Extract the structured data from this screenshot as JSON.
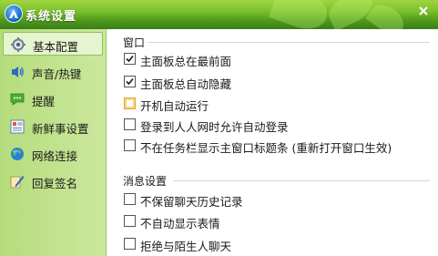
{
  "window": {
    "title": "系统设置",
    "close_label": "✕"
  },
  "sidebar": {
    "items": [
      {
        "label": "基本配置",
        "icon": "gear-icon",
        "active": true
      },
      {
        "label": "声音/热键",
        "icon": "speaker-icon",
        "active": false
      },
      {
        "label": "提醒",
        "icon": "chat-bubble-icon",
        "active": false
      },
      {
        "label": "新鲜事设置",
        "icon": "news-icon",
        "active": false
      },
      {
        "label": "网络连接",
        "icon": "globe-icon",
        "active": false
      },
      {
        "label": "回复签名",
        "icon": "pen-icon",
        "active": false
      }
    ]
  },
  "main": {
    "window_group": {
      "title": "窗口",
      "options": [
        {
          "label": "主面板总在最前面",
          "checked": true
        },
        {
          "label": "主面板总自动隐藏",
          "checked": true
        },
        {
          "label": "开机自动运行",
          "checked": false
        },
        {
          "label": "登录到人人网时允许自动登录",
          "checked": false
        },
        {
          "label": "不在任务栏显示主窗口标题条 (重新打开窗口生效)",
          "checked": false
        }
      ]
    },
    "message_group": {
      "title": "消息设置",
      "options": [
        {
          "label": "不保留聊天历史记录",
          "checked": false
        },
        {
          "label": "不自动显示表情",
          "checked": false
        },
        {
          "label": "拒绝与陌生人聊天",
          "checked": false
        }
      ]
    }
  },
  "colors": {
    "title_green": "#5aa321",
    "sidebar_green": "#c2e48f",
    "hover_orange": "#e8a02a"
  }
}
